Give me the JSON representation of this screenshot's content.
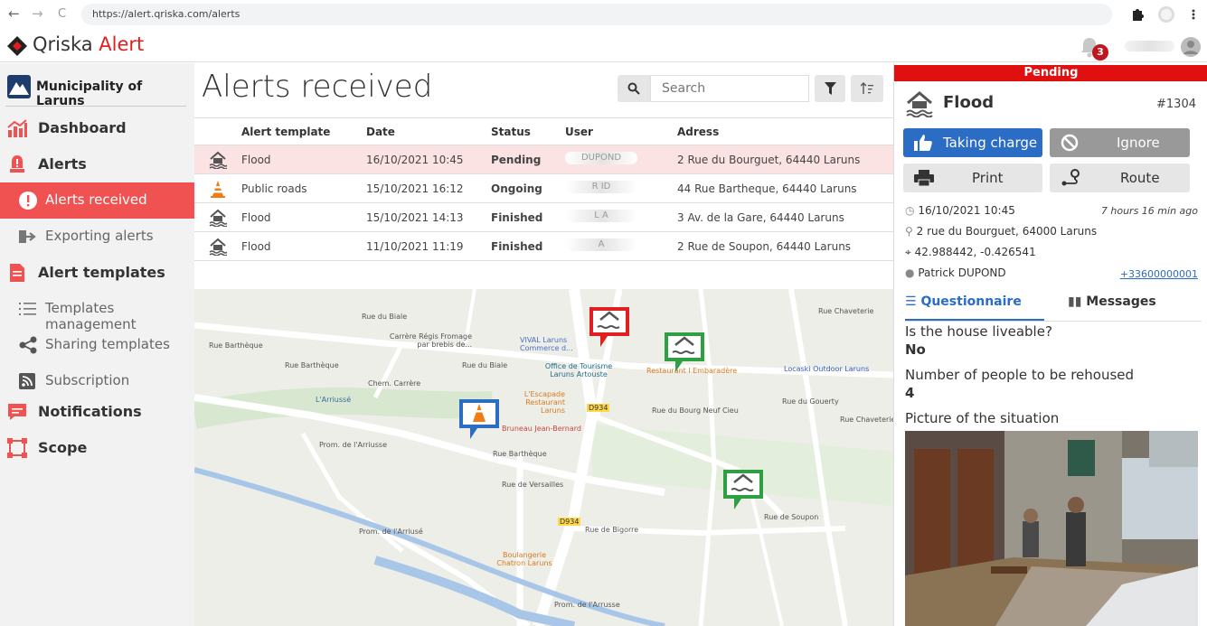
{
  "browser": {
    "back": "←",
    "forward": "→",
    "reload": "C",
    "url": "https://alert.qriska.com/alerts"
  },
  "header": {
    "brand_main": "Qriska",
    "brand_accent": "Alert",
    "notification_count": "3"
  },
  "sidebar": {
    "municipality": "Municipality of Laruns",
    "items": [
      {
        "label": "Dashboard",
        "icon": "chart-icon"
      },
      {
        "label": "Alerts",
        "icon": "alert-icon"
      },
      {
        "label": "Alerts received",
        "icon": "exclamation-icon",
        "active": true
      },
      {
        "label": "Exporting alerts",
        "icon": "export-icon"
      },
      {
        "label": "Alert templates",
        "icon": "document-icon"
      },
      {
        "label": "Templates management",
        "icon": "list-icon"
      },
      {
        "label": "Sharing templates",
        "icon": "share-icon"
      },
      {
        "label": "Subscription",
        "icon": "rss-icon"
      },
      {
        "label": "Notifications",
        "icon": "notification-icon"
      },
      {
        "label": "Scope",
        "icon": "scope-icon"
      }
    ]
  },
  "main": {
    "title": "Alerts received",
    "search_placeholder": "Search",
    "columns": [
      "Alert template",
      "Date",
      "Status",
      "User",
      "Adress"
    ],
    "rows": [
      {
        "template": "Flood",
        "date": "16/10/2021 10:45",
        "status": "Pending",
        "user": "DUPOND",
        "address": "2 Rue du Bourguet, 64440 Laruns"
      },
      {
        "template": "Public roads",
        "date": "15/10/2021 16:12",
        "status": "Ongoing",
        "user": "R   ID",
        "address": "44 Rue Bartheque, 64440 Laruns"
      },
      {
        "template": "Flood",
        "date": "15/10/2021 14:13",
        "status": "Finished",
        "user": "L   A",
        "address": "3 Av. de la Gare, 64440 Laruns"
      },
      {
        "template": "Flood",
        "date": "11/10/2021 11:19",
        "status": "Finished",
        "user": "A",
        "address": "2 Rue de Soupon, 64440 Laruns"
      }
    ],
    "map": {
      "labels": [
        "Rue du Biale",
        "Rue Barthèque",
        "Rue Barthèque",
        "Rue du Biale",
        "L'Arriussé",
        "Chem. Carrère",
        "Prom. de l'Arriusse",
        "Rue de Versailles",
        "Prom. de l'Arriusé",
        "Rue de Bigorre",
        "Rue de Soupon",
        "Rue du Bourg Neuf Cieu",
        "Rue du Gouerty",
        "Rue Chaveterie",
        "Prom. de l'Arrusse",
        "Rue Barthèque",
        "Rue Chaveterie"
      ],
      "pois": [
        "Carrère Régis Fromage par brebis de...",
        "VIVAL Laruns Commerce d...",
        "Office de Tourisme Laruns Artouste",
        "Restaurant l Embaradère",
        "Locaski Outdoor Laruns",
        "L'Escapade Restaurant Laruns",
        "Bruneau Jean-Bernard",
        "Boulangerie Chatron Laruns"
      ],
      "road_numbers": [
        "D934",
        "D934"
      ]
    }
  },
  "panel": {
    "status": "Pending",
    "title": "Flood",
    "id": "#1304",
    "buttons": {
      "take": "Taking charge",
      "ignore": "Ignore",
      "print": "Print",
      "route": "Route"
    },
    "datetime": "16/10/2021 10:45",
    "elapsed": "7 hours 16 min ago",
    "address": "2 rue du Bourguet, 64000 Laruns",
    "coords": "42.988442, -0.426541",
    "person": "Patrick DUPOND",
    "phone": "+33600000001",
    "tabs": [
      "Questionnaire",
      "Messages"
    ],
    "questions": [
      {
        "q": "Is the house liveable?",
        "a": "No"
      },
      {
        "q": "Number of people to be rehoused",
        "a": "4"
      },
      {
        "q": "Picture of the situation",
        "a": ""
      }
    ]
  },
  "colors": {
    "accent": "#e02020",
    "primary": "#2b6cc4",
    "active_sidebar": "#f05252",
    "pending_bg": "#fbe3e4",
    "success": "#3aa043"
  }
}
